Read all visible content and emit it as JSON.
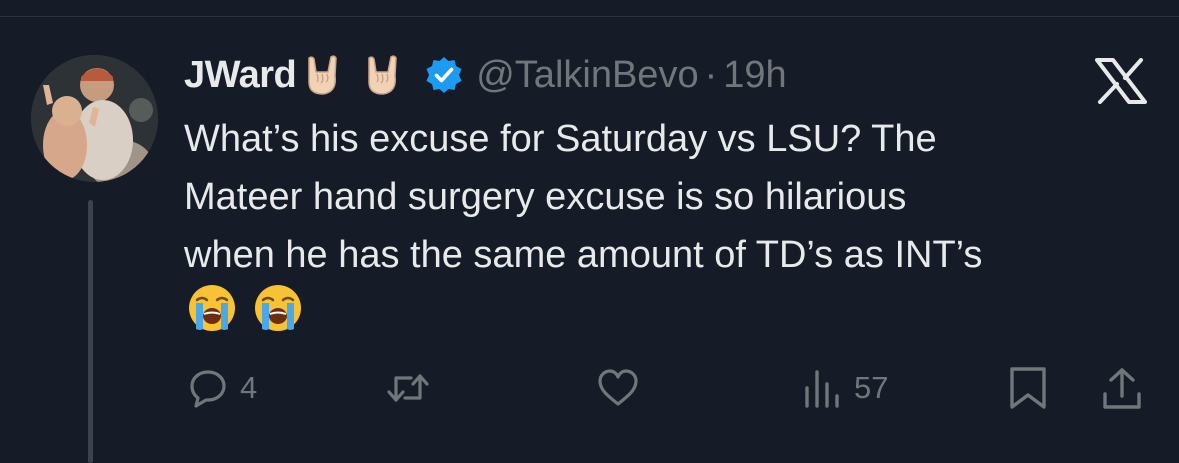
{
  "tweet": {
    "display_name": "JWard",
    "name_emojis": [
      "sign-of-horns-emoji",
      "sign-of-horns-emoji"
    ],
    "verified": true,
    "handle": "@TalkinBevo",
    "separator": "·",
    "timestamp": "19h",
    "text": "What’s his excuse for Saturday vs LSU? The\nMateer hand surgery excuse is so hilarious\nwhen he has the same amount of TD’s as INT’s",
    "trailing_emojis": [
      "loudly-crying-face-emoji",
      "loudly-crying-face-emoji"
    ]
  },
  "actions": {
    "reply": {
      "icon": "reply-icon",
      "count": "4"
    },
    "retweet": {
      "icon": "retweet-icon",
      "count": ""
    },
    "like": {
      "icon": "heart-icon",
      "count": ""
    },
    "views": {
      "icon": "views-chart-icon",
      "count": "57"
    },
    "bookmark": {
      "icon": "bookmark-icon"
    },
    "share": {
      "icon": "share-icon"
    }
  },
  "brand": {
    "logo": "x-logo",
    "accent": "#1d9bf0",
    "text_color": "#e7e9ea",
    "muted_color": "#71767b",
    "background": "#151c27"
  }
}
